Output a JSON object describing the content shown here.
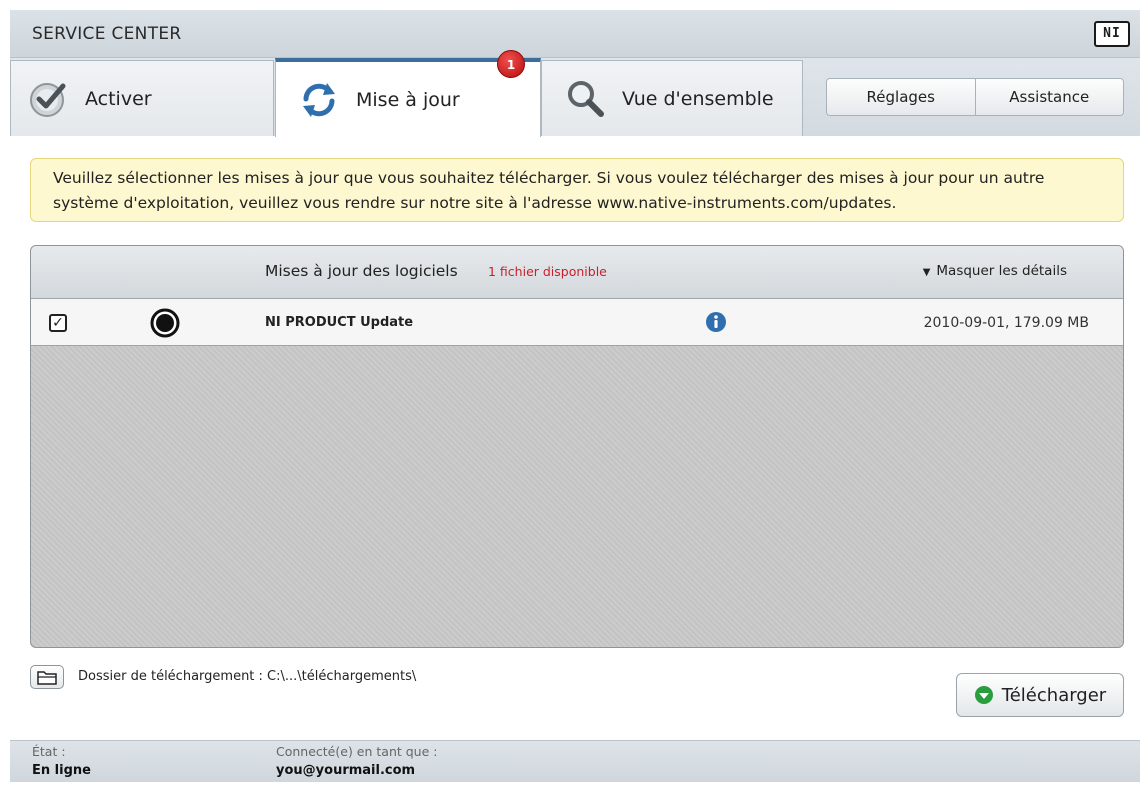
{
  "window": {
    "title": "SERVICE CENTER",
    "logo_text": "NI"
  },
  "tabs": [
    {
      "label": "Activer",
      "icon": "check-badge-icon"
    },
    {
      "label": "Mise à jour",
      "icon": "refresh-icon",
      "badge": "1"
    },
    {
      "label": "Vue d'ensemble",
      "icon": "magnifier-icon"
    }
  ],
  "toolbar": {
    "settings_label": "Réglages",
    "support_label": "Assistance"
  },
  "notice": {
    "text": "Veuillez sélectionner les mises à jour que vous souhaitez télécharger. Si vous voulez télécharger des mises à jour pour un autre système d'exploitation, veuillez vous rendre sur notre site à l'adresse www.native-instruments.com/updates."
  },
  "updates_panel": {
    "title": "Mises à jour des logiciels",
    "count_label": "1 fichier disponible",
    "toggle_label": "Masquer les détails",
    "rows": [
      {
        "checked": true,
        "check_glyph": "✓",
        "name": "NI PRODUCT Update",
        "meta": "2010-09-01, 179.09 MB"
      }
    ]
  },
  "folder": {
    "label": "Dossier de téléchargement : C:\\...\\téléchargements\\"
  },
  "download_button": {
    "label": "Télécharger"
  },
  "status": {
    "state_label": "État :",
    "state_value": "En ligne",
    "user_label": "Connecté(e) en tant que :",
    "user_value": "you@yourmail.com"
  },
  "colors": {
    "accent": "#3c6e9d",
    "notice_bg": "#fdf8cf",
    "count_red": "#c8212b",
    "download_green": "#2a9d3f",
    "badge_red": "#d41c1c"
  }
}
